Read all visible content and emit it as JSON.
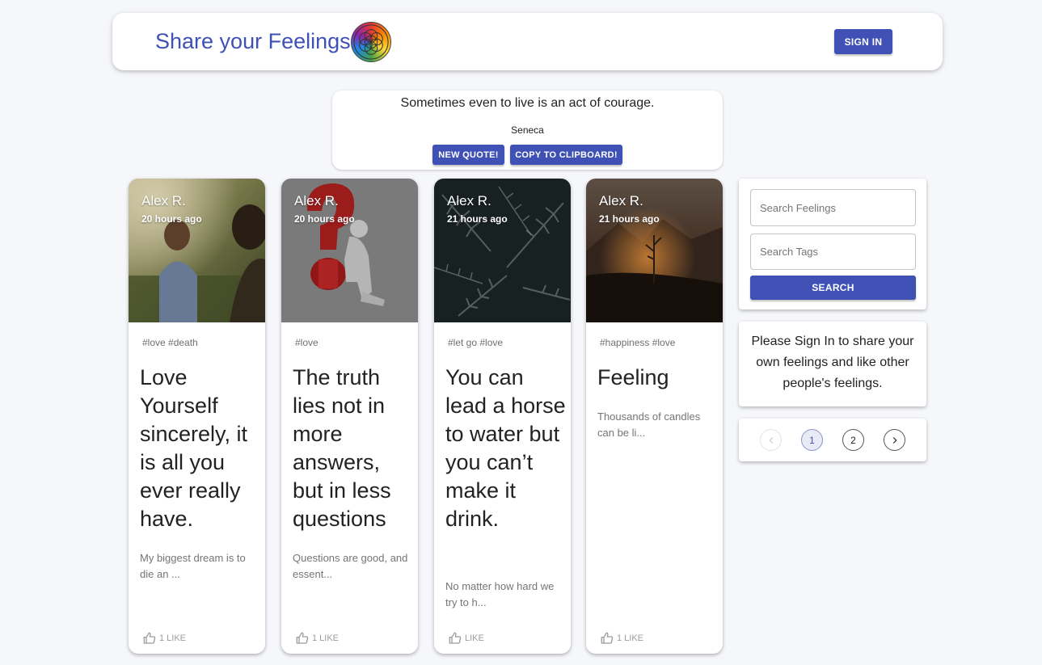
{
  "header": {
    "title": "Share your Feelings",
    "sign_in_label": "SIGN IN"
  },
  "quote": {
    "text": "Sometimes even to live is an act of courage.",
    "author": "Seneca",
    "new_quote_label": "NEW QUOTE!",
    "copy_label": "COPY TO CLIPBOARD!"
  },
  "cards": [
    {
      "author": "Alex R.",
      "time": "20 hours ago",
      "tags": "#love #death",
      "title": "Love Yourself sincerely, it is all you ever really have.",
      "excerpt": "My biggest dream is to die an ...",
      "likes": "1 LIKE",
      "image": "woman-in-sunlit-field"
    },
    {
      "author": "Alex R.",
      "time": "20 hours ago",
      "tags": "#love",
      "title": "The truth lies not in more answers, but in less questions",
      "excerpt": "Questions are good, and essent...",
      "likes": "1 LIKE",
      "image": "figure-with-red-question-mark"
    },
    {
      "author": "Alex R.",
      "time": "21 hours ago",
      "tags": "#let go #love",
      "title": "You can lead a horse to water but you can’t make it drink.",
      "excerpt": "No matter how hard we try to h...",
      "likes": "LIKE",
      "image": "dark-fern-leaves"
    },
    {
      "author": "Alex R.",
      "time": "21 hours ago",
      "tags": "#happiness #love",
      "title": "Feeling",
      "excerpt": "Thousands of candles can be li...",
      "likes": "1 LIKE",
      "image": "sunset-mountains-plant"
    }
  ],
  "search": {
    "feelings_placeholder": "Search Feelings",
    "tags_placeholder": "Search Tags",
    "button_label": "SEARCH"
  },
  "info": {
    "text": "Please Sign In to share your own feelings and like other people's feelings."
  },
  "pagination": {
    "pages": [
      "1",
      "2"
    ],
    "current_page": "1"
  },
  "colors": {
    "primary": "#3f51b5",
    "background": "#f6f7fb"
  }
}
